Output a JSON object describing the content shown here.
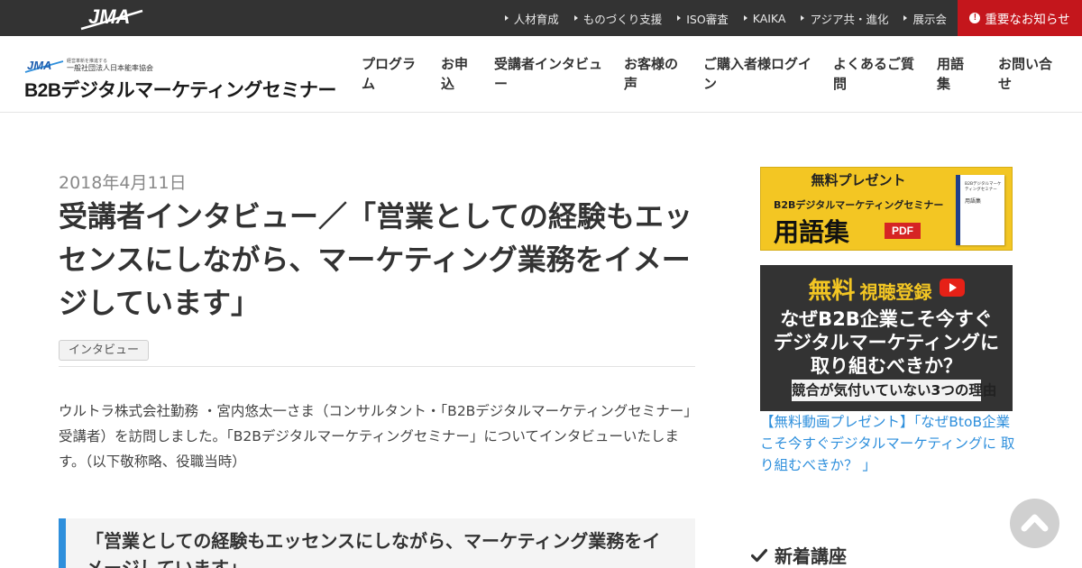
{
  "topbar": {
    "logo_text": "JMA",
    "links": [
      "人材育成",
      "ものづくり支援",
      "ISO審査",
      "KAIKA",
      "アジア共・進化",
      "展示会"
    ],
    "notice": "重要なお知らせ"
  },
  "header": {
    "brand_tagline": "経営革新を推進する",
    "brand_org": "一般社団法人日本能率協会",
    "brand_jma": "JMA",
    "brand_name": "B2Bデジタルマーケティングセミナー",
    "nav": [
      {
        "line1": "プログラ",
        "line2": "ム"
      },
      {
        "line1": "お申",
        "line2": "込"
      },
      {
        "line1": "受講者インタビュ",
        "line2": "ー"
      },
      {
        "line1": "お客様の",
        "line2": "声"
      },
      {
        "line1": "ご購入者様ログイ",
        "line2": "ン"
      },
      {
        "line1": "よくあるご質",
        "line2": "問"
      },
      {
        "line1": "用語",
        "line2": "集"
      },
      {
        "line1": "お問い合",
        "line2": "せ"
      }
    ]
  },
  "article": {
    "date": "2018年4月11日",
    "title": "受講者インタビュー／「営業としての経験もエッセンスにしながら、マーケティング業務をイメージしています」",
    "tag": "インタビュー",
    "lead": "ウルトラ株式会社勤務 ・宮内悠太一さま（コンサルタント・「B2Bデジタルマーケティングセミナー」受講者）を訪問しました。「B2Bデジタルマーケティングセミナー」についてインタビューいたします。（以下敬称略、役職当時）",
    "section_heading": "「営業としての経験もエッセンスにしながら、マーケティング業務をイメージしています」"
  },
  "sidebar": {
    "banner1": {
      "head": "無料プレゼント",
      "sub": "B2Bデジタルマーケティングセミナー",
      "main": "用語集",
      "pdf": "PDF",
      "book_title": "B2Bデジタルマーケティングセミナー",
      "book_sub": "用語集"
    },
    "banner2": {
      "free": "無料",
      "register": "視聴登録",
      "line1": "なぜB2B企業こそ今すぐ",
      "line2": "デジタルマーケティングに",
      "line3": "取り組むべきか？",
      "foot": "競合が気付いていない3つの理由"
    },
    "link_text": "【無料動画プレゼント】「なぜBtoB企業こそ今すぐデジタルマーケティングに 取り組むべきか？ 」",
    "new_heading": "新着講座"
  },
  "colors": {
    "topbar": "#333333",
    "notice": "#c4161c",
    "accent_blue": "#2e8fdc",
    "banner_yellow": "#f3c623"
  },
  "icons": {
    "check": "check-icon",
    "to_top": "chevron-up-icon",
    "notice": "exclamation-circle-icon"
  }
}
